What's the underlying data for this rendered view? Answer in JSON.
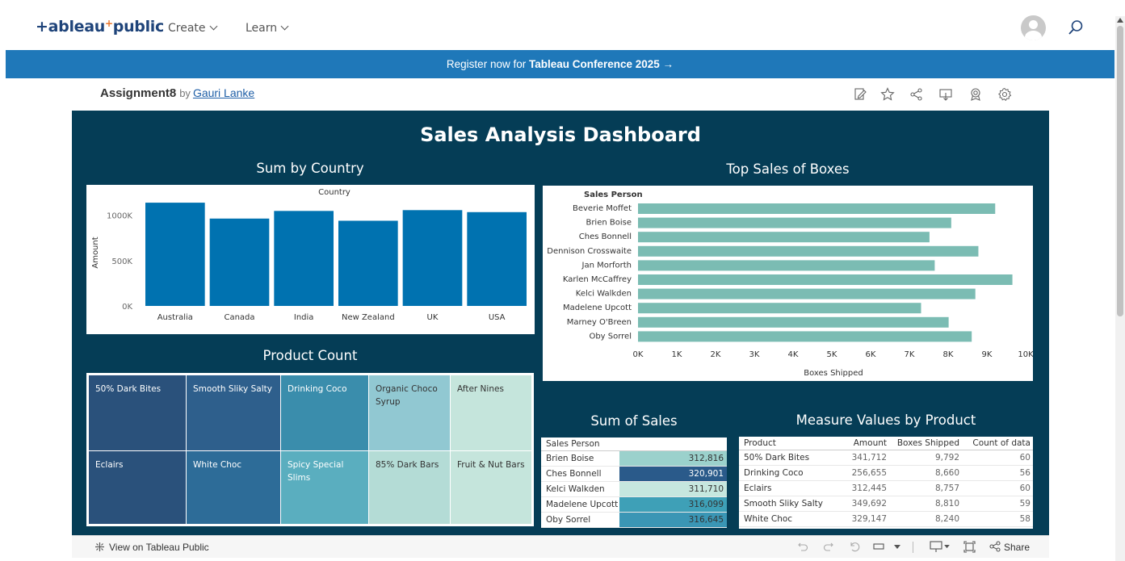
{
  "nav": {
    "logo": "+ableau",
    "logo_plus": "+",
    "logo_suffix": "public",
    "items": [
      {
        "label": "Create"
      },
      {
        "label": "Learn"
      }
    ]
  },
  "banner": {
    "prefix": "Register now for ",
    "bold": "Tableau Conference 2025",
    "arrow": " →"
  },
  "viz": {
    "title": "Assignment8",
    "by": "by",
    "author": "Gauri Lanke"
  },
  "dashboard": {
    "title": "Sales Analysis Dashboard",
    "sections": {
      "country": "Sum by Country",
      "top_sales": "Top Sales of Boxes",
      "product_count": "Product Count",
      "sum_sales": "Sum of Sales",
      "measure_values": "Measure Values by Product"
    }
  },
  "chart_data": [
    {
      "type": "bar",
      "title": "Country",
      "ylabel": "Amount",
      "categories": [
        "Australia",
        "Canada",
        "India",
        "New Zealand",
        "UK",
        "USA"
      ],
      "values": [
        1137000,
        962000,
        1046000,
        938000,
        1055000,
        1033000
      ],
      "yticks": [
        "0K",
        "500K",
        "1000K"
      ],
      "ylim": [
        0,
        1200000
      ],
      "color": "#0072b0"
    },
    {
      "type": "bar",
      "orientation": "horizontal",
      "header": "Sales Person",
      "xlabel": "Boxes Shipped",
      "categories": [
        "Beverie Moffet",
        "Brien Boise",
        "Ches Bonnell",
        "Dennison Crosswaite",
        "Jan Morforth",
        "Karlen McCaffrey",
        "Kelci Walkden",
        "Madelene Upcott",
        "Marney O'Breen",
        "Oby Sorrel"
      ],
      "values": [
        9214,
        8080,
        7519,
        8780,
        7654,
        9658,
        8702,
        7302,
        8013,
        8608
      ],
      "xticks": [
        "0K",
        "1K",
        "2K",
        "3K",
        "4K",
        "5K",
        "6K",
        "7K",
        "8K",
        "9K",
        "10K"
      ],
      "xlim": [
        0,
        10000
      ],
      "color": "#7bbcb3"
    }
  ],
  "treemap": [
    {
      "label": "50% Dark Bites",
      "color": "#2a517b"
    },
    {
      "label": "Eclairs",
      "color": "#2a517b"
    },
    {
      "label": "Smooth Sliky Salty",
      "color": "#2e5f8c"
    },
    {
      "label": "White Choc",
      "color": "#2d6c98"
    },
    {
      "label": "Drinking Coco",
      "color": "#3a8dac"
    },
    {
      "label": "Spicy Special Slims",
      "color": "#5aaebf"
    },
    {
      "label": "Organic Choco Syrup",
      "color": "#91c8d2"
    },
    {
      "label": "85% Dark Bars",
      "color": "#b4dcd6"
    },
    {
      "label": "After Nines",
      "color": "#c5e5dc"
    },
    {
      "label": "Fruit & Nut Bars",
      "color": "#c5e5dc"
    }
  ],
  "sum_sales": {
    "header": "Sales Person",
    "rows": [
      {
        "name": "Brien Boise",
        "value": "312,816",
        "color": "#9bd1cc"
      },
      {
        "name": "Ches Bonnell",
        "value": "320,901",
        "color": "#2a5a8a"
      },
      {
        "name": "Kelci Walkden",
        "value": "311,710",
        "color": "#c6e7df"
      },
      {
        "name": "Madelene Upcott",
        "value": "316,099",
        "color": "#3ea0b7"
      },
      {
        "name": "Oby Sorrel",
        "value": "316,645",
        "color": "#3a96b5"
      }
    ]
  },
  "measure_values": {
    "headers": [
      "Product",
      "Amount",
      "Boxes Shipped",
      "Count of data"
    ],
    "rows": [
      [
        "50% Dark Bites",
        "341,712",
        "9,792",
        "60"
      ],
      [
        "Drinking Coco",
        "256,655",
        "8,660",
        "56"
      ],
      [
        "Eclairs",
        "312,445",
        "8,757",
        "60"
      ],
      [
        "Smooth Sliky Salty",
        "349,692",
        "8,810",
        "59"
      ],
      [
        "White Choc",
        "329,147",
        "8,240",
        "58"
      ]
    ]
  },
  "bottombar": {
    "view_label": "View on Tableau Public",
    "share_label": "Share"
  }
}
